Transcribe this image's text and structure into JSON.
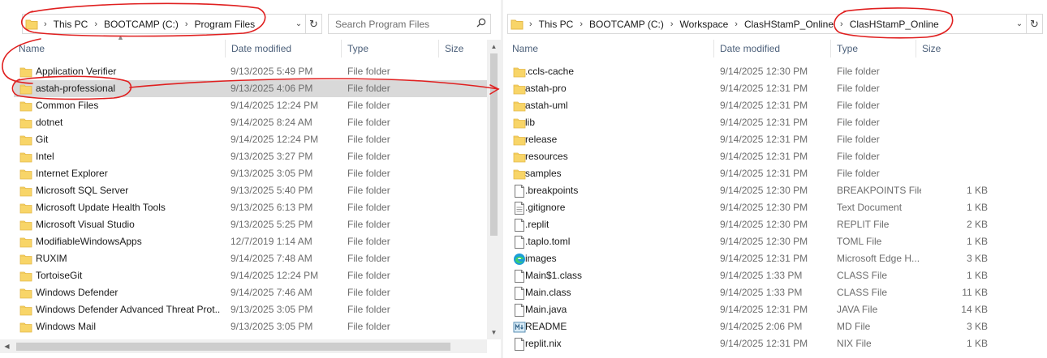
{
  "left": {
    "breadcrumb": [
      "This PC",
      "BOOTCAMP (C:)",
      "Program Files"
    ],
    "search_placeholder": "Search Program Files",
    "columns": [
      "Name",
      "Date modified",
      "Type",
      "Size"
    ],
    "selected_index": 1,
    "rows": [
      {
        "name": "Application Verifier",
        "date": "9/13/2025 5:49 PM",
        "type": "File folder",
        "size": "",
        "icon": "folder-icon"
      },
      {
        "name": "astah-professional",
        "date": "9/13/2025 4:06 PM",
        "type": "File folder",
        "size": "",
        "icon": "folder-icon"
      },
      {
        "name": "Common Files",
        "date": "9/14/2025 12:24 PM",
        "type": "File folder",
        "size": "",
        "icon": "folder-icon"
      },
      {
        "name": "dotnet",
        "date": "9/14/2025 8:24 AM",
        "type": "File folder",
        "size": "",
        "icon": "folder-icon"
      },
      {
        "name": "Git",
        "date": "9/14/2025 12:24 PM",
        "type": "File folder",
        "size": "",
        "icon": "folder-icon"
      },
      {
        "name": "Intel",
        "date": "9/13/2025 3:27 PM",
        "type": "File folder",
        "size": "",
        "icon": "folder-icon"
      },
      {
        "name": "Internet Explorer",
        "date": "9/13/2025 3:05 PM",
        "type": "File folder",
        "size": "",
        "icon": "folder-icon"
      },
      {
        "name": "Microsoft SQL Server",
        "date": "9/13/2025 5:40 PM",
        "type": "File folder",
        "size": "",
        "icon": "folder-icon"
      },
      {
        "name": "Microsoft Update Health Tools",
        "date": "9/13/2025 6:13 PM",
        "type": "File folder",
        "size": "",
        "icon": "folder-icon"
      },
      {
        "name": "Microsoft Visual Studio",
        "date": "9/13/2025 5:25 PM",
        "type": "File folder",
        "size": "",
        "icon": "folder-icon"
      },
      {
        "name": "ModifiableWindowsApps",
        "date": "12/7/2019 1:14 AM",
        "type": "File folder",
        "size": "",
        "icon": "folder-icon"
      },
      {
        "name": "RUXIM",
        "date": "9/14/2025 7:48 AM",
        "type": "File folder",
        "size": "",
        "icon": "folder-icon"
      },
      {
        "name": "TortoiseGit",
        "date": "9/14/2025 12:24 PM",
        "type": "File folder",
        "size": "",
        "icon": "folder-icon"
      },
      {
        "name": "Windows Defender",
        "date": "9/14/2025 7:46 AM",
        "type": "File folder",
        "size": "",
        "icon": "folder-icon"
      },
      {
        "name": "Windows Defender Advanced Threat Prot...",
        "date": "9/13/2025 3:05 PM",
        "type": "File folder",
        "size": "",
        "icon": "folder-icon"
      },
      {
        "name": "Windows Mail",
        "date": "9/13/2025 3:05 PM",
        "type": "File folder",
        "size": "",
        "icon": "folder-icon"
      }
    ]
  },
  "right": {
    "breadcrumb": [
      "This PC",
      "BOOTCAMP (C:)",
      "Workspace",
      "ClasHStamP_Online",
      "ClasHStamP_Online"
    ],
    "columns": [
      "Name",
      "Date modified",
      "Type",
      "Size"
    ],
    "rows": [
      {
        "name": ".ccls-cache",
        "date": "9/14/2025 12:30 PM",
        "type": "File folder",
        "size": "",
        "icon": "folder-icon"
      },
      {
        "name": "astah-pro",
        "date": "9/14/2025 12:31 PM",
        "type": "File folder",
        "size": "",
        "icon": "folder-icon"
      },
      {
        "name": "astah-uml",
        "date": "9/14/2025 12:31 PM",
        "type": "File folder",
        "size": "",
        "icon": "folder-icon"
      },
      {
        "name": "lib",
        "date": "9/14/2025 12:31 PM",
        "type": "File folder",
        "size": "",
        "icon": "folder-icon"
      },
      {
        "name": "release",
        "date": "9/14/2025 12:31 PM",
        "type": "File folder",
        "size": "",
        "icon": "folder-icon"
      },
      {
        "name": "resources",
        "date": "9/14/2025 12:31 PM",
        "type": "File folder",
        "size": "",
        "icon": "folder-icon"
      },
      {
        "name": "samples",
        "date": "9/14/2025 12:31 PM",
        "type": "File folder",
        "size": "",
        "icon": "folder-icon"
      },
      {
        "name": ".breakpoints",
        "date": "9/14/2025 12:30 PM",
        "type": "BREAKPOINTS File",
        "size": "1 KB",
        "icon": "file-icon"
      },
      {
        "name": ".gitignore",
        "date": "9/14/2025 12:30 PM",
        "type": "Text Document",
        "size": "1 KB",
        "icon": "text-file-icon"
      },
      {
        "name": ".replit",
        "date": "9/14/2025 12:30 PM",
        "type": "REPLIT File",
        "size": "2 KB",
        "icon": "file-icon"
      },
      {
        "name": ".taplo.toml",
        "date": "9/14/2025 12:30 PM",
        "type": "TOML File",
        "size": "1 KB",
        "icon": "file-icon"
      },
      {
        "name": "images",
        "date": "9/14/2025 12:31 PM",
        "type": "Microsoft Edge H...",
        "size": "3 KB",
        "icon": "edge-icon"
      },
      {
        "name": "Main$1.class",
        "date": "9/14/2025 1:33 PM",
        "type": "CLASS File",
        "size": "1 KB",
        "icon": "file-icon"
      },
      {
        "name": "Main.class",
        "date": "9/14/2025 1:33 PM",
        "type": "CLASS File",
        "size": "11 KB",
        "icon": "file-icon"
      },
      {
        "name": "Main.java",
        "date": "9/14/2025 12:31 PM",
        "type": "JAVA File",
        "size": "14 KB",
        "icon": "file-icon"
      },
      {
        "name": "README",
        "date": "9/14/2025 2:06 PM",
        "type": "MD File",
        "size": "3 KB",
        "icon": "markdown-file-icon"
      },
      {
        "name": "replit.nix",
        "date": "9/14/2025 12:31 PM",
        "type": "NIX File",
        "size": "1 KB",
        "icon": "file-icon"
      }
    ]
  },
  "colors": {
    "folder": "#f8d568",
    "folder_dark": "#e4b847",
    "selection": "#d9d9d9",
    "annotation": "#e02020",
    "header_text": "#4c607a"
  }
}
